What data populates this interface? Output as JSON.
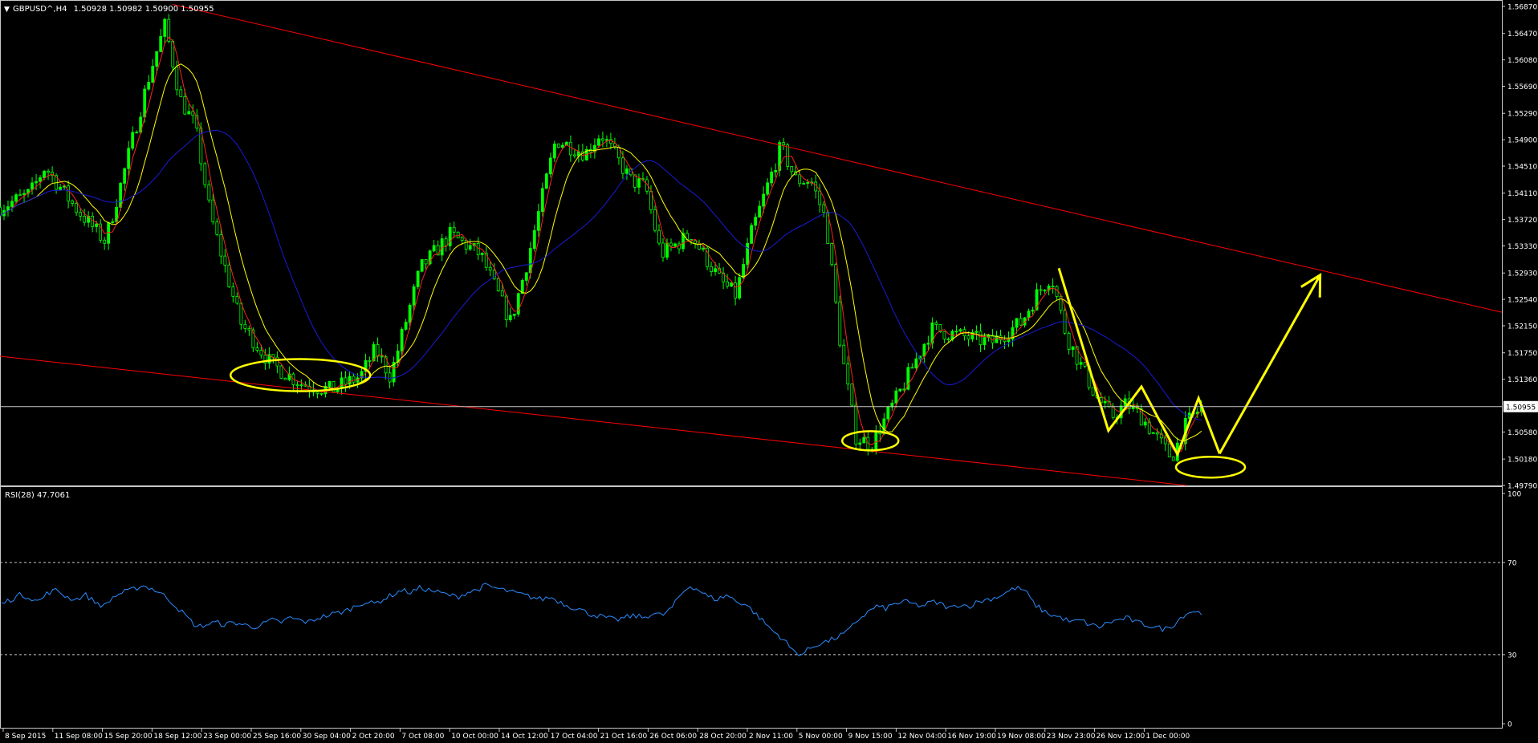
{
  "header": {
    "symbol": "GBPUSD^,H4",
    "ohlc": "1.50928 1.50982 1.50900 1.50955"
  },
  "rsi_header": {
    "label": "RSI(28) 47.7061"
  },
  "current_price_label": "1.50955",
  "colors": {
    "background": "#000000",
    "frame": "#c8c8c8",
    "candle": "#00ff00",
    "trendline": "#ff0000",
    "ma_fast": "#ff2020",
    "ma_mid": "#ffff00",
    "ma_slow": "#1a1ad8",
    "rsi_line": "#2a8cff",
    "annotation": "#ffff00",
    "current_price_line": "#c8c8c8"
  },
  "chart_data": [
    {
      "type": "candlestick",
      "title": "GBPUSD^,H4",
      "ylim": [
        1.4979,
        1.5687
      ],
      "y_ticks": [
        "1.56870",
        "1.56470",
        "1.56080",
        "1.55690",
        "1.55290",
        "1.54900",
        "1.54510",
        "1.54110",
        "1.53720",
        "1.53330",
        "1.52930",
        "1.52540",
        "1.52150",
        "1.51750",
        "1.51360",
        "1.50955",
        "1.50580",
        "1.50180",
        "1.49790"
      ],
      "x_ticks": [
        "8 Sep 2015",
        "11 Sep 08:00",
        "15 Sep 20:00",
        "18 Sep 12:00",
        "23 Sep 00:00",
        "25 Sep 16:00",
        "30 Sep 04:00",
        "2 Oct 20:00",
        "7 Oct 08:00",
        "10 Oct 00:00",
        "14 Oct 12:00",
        "17 Oct 04:00",
        "21 Oct 16:00",
        "26 Oct 06:00",
        "28 Oct 20:00",
        "2 Nov 11:00",
        "5 Nov 00:00",
        "9 Nov 15:00",
        "12 Nov 04:00",
        "16 Nov 19:00",
        "19 Nov 08:00",
        "23 Nov 23:00",
        "26 Nov 12:00",
        "1 Dec 00:00"
      ],
      "current_price": 1.50955,
      "price_path": [
        [
          0,
          1.539
        ],
        [
          0.02,
          1.541
        ],
        [
          0.03,
          1.545
        ],
        [
          0.05,
          1.539
        ],
        [
          0.07,
          1.534
        ],
        [
          0.08,
          1.542
        ],
        [
          0.1,
          1.559
        ],
        [
          0.11,
          1.566
        ],
        [
          0.12,
          1.555
        ],
        [
          0.13,
          1.551
        ],
        [
          0.14,
          1.538
        ],
        [
          0.16,
          1.522
        ],
        [
          0.18,
          1.516
        ],
        [
          0.2,
          1.513
        ],
        [
          0.22,
          1.512
        ],
        [
          0.24,
          1.514
        ],
        [
          0.25,
          1.518
        ],
        [
          0.26,
          1.514
        ],
        [
          0.28,
          1.53
        ],
        [
          0.3,
          1.535
        ],
        [
          0.32,
          1.532
        ],
        [
          0.33,
          1.527
        ],
        [
          0.34,
          1.522
        ],
        [
          0.35,
          1.53
        ],
        [
          0.37,
          1.549
        ],
        [
          0.39,
          1.547
        ],
        [
          0.4,
          1.55
        ],
        [
          0.42,
          1.543
        ],
        [
          0.43,
          1.542
        ],
        [
          0.44,
          1.532
        ],
        [
          0.46,
          1.535
        ],
        [
          0.48,
          1.528
        ],
        [
          0.49,
          1.526
        ],
        [
          0.5,
          1.535
        ],
        [
          0.52,
          1.548
        ],
        [
          0.53,
          1.543
        ],
        [
          0.54,
          1.543
        ],
        [
          0.55,
          1.537
        ],
        [
          0.56,
          1.518
        ],
        [
          0.57,
          1.505
        ],
        [
          0.58,
          1.504
        ],
        [
          0.59,
          1.508
        ],
        [
          0.6,
          1.512
        ],
        [
          0.62,
          1.521
        ],
        [
          0.64,
          1.52
        ],
        [
          0.66,
          1.519
        ],
        [
          0.68,
          1.522
        ],
        [
          0.69,
          1.526
        ],
        [
          0.7,
          1.529
        ],
        [
          0.71,
          1.52
        ],
        [
          0.73,
          1.511
        ],
        [
          0.74,
          1.508
        ],
        [
          0.75,
          1.51
        ],
        [
          0.76,
          1.508
        ],
        [
          0.77,
          1.505
        ],
        [
          0.78,
          1.502
        ],
        [
          0.79,
          1.507
        ],
        [
          0.8,
          1.5095
        ]
      ],
      "moving_averages": [
        "fast (red)",
        "medium (yellow)",
        "slow (blue)"
      ],
      "trendlines": [
        {
          "from": [
            0.115,
            1.569
          ],
          "to": [
            1.0,
            1.5235
          ]
        },
        {
          "from": [
            0.0,
            1.517
          ],
          "to": [
            0.79,
            1.4979
          ]
        }
      ],
      "annotations": [
        "yellow ellipses at lows: 30 Sep, 5 Nov, 1 Dec",
        "yellow zigzag projection arrow toward upper trendline"
      ]
    },
    {
      "type": "line",
      "title": "RSI(28) 47.7061",
      "ylim": [
        0,
        100
      ],
      "y_ticks": [
        "100",
        "70",
        "30",
        "0"
      ],
      "levels": [
        70,
        30
      ],
      "series": [
        {
          "name": "RSI(28)",
          "values": [
            52,
            54,
            56,
            55,
            53,
            57,
            58,
            55,
            54,
            56,
            53,
            51,
            55,
            57,
            58,
            60,
            59,
            57,
            54,
            50,
            46,
            42,
            43,
            44,
            43,
            44,
            43,
            42,
            43,
            45,
            44,
            46,
            45,
            44,
            46,
            47,
            48,
            49,
            51,
            53,
            52,
            54,
            56,
            58,
            57,
            59,
            58,
            57,
            56,
            55,
            57,
            58,
            60,
            59,
            58,
            57,
            56,
            55,
            54,
            55,
            53,
            51,
            50,
            48,
            47,
            46,
            45,
            46,
            47,
            46,
            48,
            47,
            50,
            56,
            60,
            58,
            55,
            54,
            56,
            53,
            52,
            48,
            44,
            40,
            37,
            32,
            30,
            33,
            35,
            36,
            38,
            40,
            45,
            48,
            51,
            50,
            52,
            53,
            52,
            51,
            53,
            52,
            50,
            52,
            51,
            53,
            54,
            55,
            57,
            59,
            58,
            52,
            49,
            47,
            46,
            44,
            45,
            43,
            42,
            44,
            45,
            46,
            44,
            43,
            42,
            41,
            43,
            47,
            49,
            48
          ]
        }
      ]
    }
  ]
}
